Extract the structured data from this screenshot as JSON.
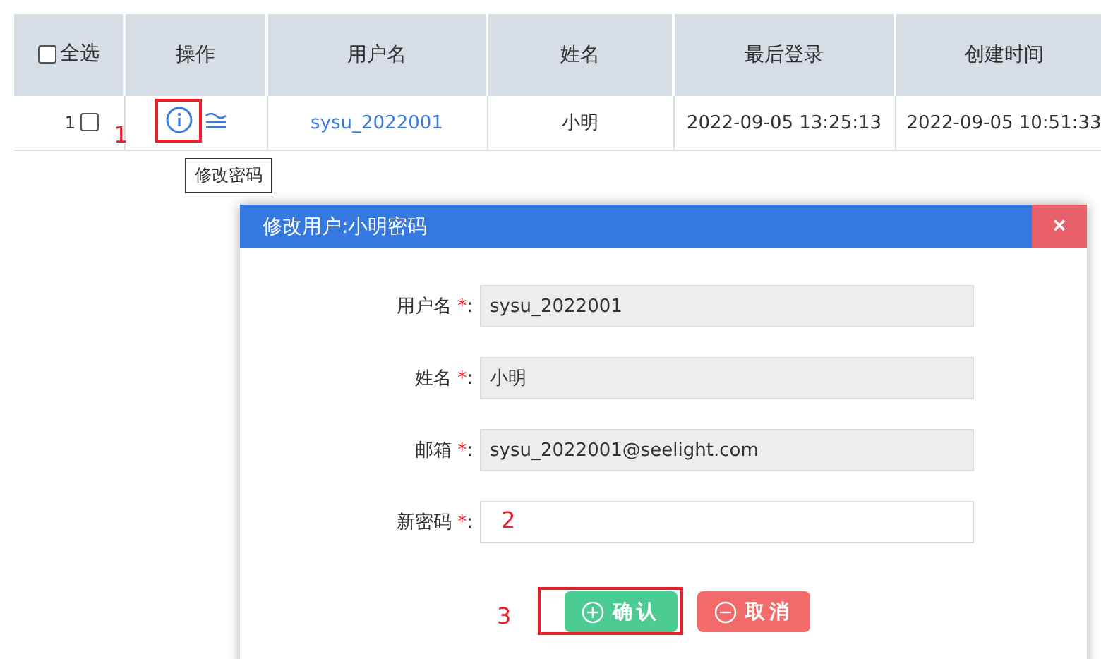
{
  "table": {
    "select_all": {
      "label": "全选",
      "checked": false
    },
    "columns": [
      "操作",
      "用户名",
      "姓名",
      "最后登录",
      "创建时间"
    ],
    "rows": [
      {
        "index": "1",
        "checked": false,
        "action_highlighted": true,
        "marker": "1",
        "username": "sysu_2022001",
        "name": "小明",
        "last_login": "2022-09-05 13:25:13",
        "created": "2022-09-05 10:51:33"
      }
    ]
  },
  "tooltip": "修改密码",
  "dialog": {
    "title": "修改用户:小明密码",
    "close": "×",
    "fields": [
      {
        "label": "用户名",
        "required_mark": "*",
        "separator": ":",
        "value": "sysu_2022001",
        "disabled": true
      },
      {
        "label": "姓名",
        "required_mark": "*",
        "separator": ":",
        "value": "小明",
        "disabled": true
      },
      {
        "label": "邮箱",
        "required_mark": "*",
        "separator": ":",
        "value": "sysu_2022001@seelight.com",
        "disabled": true
      },
      {
        "label": "新密码",
        "required_mark": "*",
        "separator": ":",
        "disabled": false,
        "marker": "2"
      }
    ],
    "buttons_marker": "3",
    "buttons": [
      {
        "label": "确认",
        "kind": "confirm",
        "highlighted": true
      },
      {
        "label": "取消",
        "kind": "cancel",
        "highlighted": false
      }
    ]
  }
}
